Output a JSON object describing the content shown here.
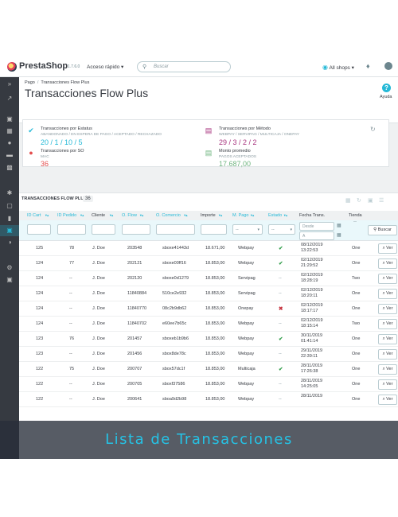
{
  "app": {
    "logo": "PrestaShop",
    "version": "1.7.6.0"
  },
  "topbar": {
    "quick_access": "Acceso rápido ▾",
    "search_placeholder": "Buscar",
    "shops": "All shops ▾"
  },
  "breadcrumb": {
    "parent": "Pago",
    "current": "Transacciones Flow Plus"
  },
  "page": {
    "title": "Transacciones Flow Plus",
    "help_label": "Ayuda"
  },
  "kpis": {
    "estatus": {
      "label": "Transacciones por Estatus",
      "sub": "ABANDONADO / EN ESPERA DE PAGO / ACEPTADO / RECHAZADO",
      "value": "20 / 1 / 10 / 5"
    },
    "metodo": {
      "label": "Transacciones por Método",
      "sub": "WEBPAY / SERVIPAG / MULTICAJA / ONEPAY",
      "value": "29 / 3 / 2 / 2"
    },
    "so": {
      "label": "Transacciones por SO",
      "sub": "MAC",
      "value": "36"
    },
    "monto": {
      "label": "Monto promedio",
      "sub": "PAGOS ACEPTADOS",
      "value": "17.687,00"
    }
  },
  "table": {
    "title": "TRANSACCIONES FLOW PLUS",
    "count": "36",
    "headers": [
      "ID Cart",
      "ID Pedido",
      "Cliente",
      "O. Flow",
      "O. Comercio",
      "Importe",
      "M. Pago",
      "Estado",
      "Fecha Trans.",
      "Tienda"
    ],
    "filters": {
      "select_placeholder": "--",
      "date_from": "Desde",
      "date_to": "A",
      "tienda_placeholder": "--",
      "search_button": "Buscar"
    },
    "view_label": "Ver",
    "rows": [
      {
        "cart": "125",
        "order": "78",
        "client": "J. Doe",
        "flow": "203548",
        "comercio": "sboxe41443d",
        "amount": "18.671,00",
        "method": "Webpay",
        "status": "ok",
        "date": "08/12/2019",
        "time": "13:22:53",
        "shop": "One"
      },
      {
        "cart": "124",
        "order": "77",
        "client": "J. Doe",
        "flow": "202121",
        "comercio": "sboxe00ff16",
        "amount": "18.853,00",
        "method": "Webpay",
        "status": "ok",
        "date": "02/12/2019",
        "time": "21:29:52",
        "shop": "One"
      },
      {
        "cart": "124",
        "order": "--",
        "client": "J. Doe",
        "flow": "202120",
        "comercio": "sboxe0d1279",
        "amount": "18.853,00",
        "method": "Servipag",
        "status": "--",
        "date": "02/12/2019",
        "time": "18:28:19",
        "shop": "Two"
      },
      {
        "cart": "124",
        "order": "--",
        "client": "J. Doe",
        "flow": "11840884",
        "comercio": "510ce2e932",
        "amount": "18.853,00",
        "method": "Servipag",
        "status": "--",
        "date": "02/12/2019",
        "time": "18:20:11",
        "shop": "One"
      },
      {
        "cart": "124",
        "order": "--",
        "client": "J. Doe",
        "flow": "11840770",
        "comercio": "08c2b9db62",
        "amount": "18.853,00",
        "method": "Onepay",
        "status": "x",
        "date": "02/12/2019",
        "time": "18:17:17",
        "shop": "One"
      },
      {
        "cart": "124",
        "order": "--",
        "client": "J. Doe",
        "flow": "11840702",
        "comercio": "e60ee7b65c",
        "amount": "18.853,00",
        "method": "Webpay",
        "status": "--",
        "date": "02/12/2019",
        "time": "18:15:14",
        "shop": "Two"
      },
      {
        "cart": "123",
        "order": "76",
        "client": "J. Doe",
        "flow": "201457",
        "comercio": "sboxeb1b9b6",
        "amount": "18.853,00",
        "method": "Webpay",
        "status": "ok",
        "date": "30/11/2019",
        "time": "01:41:14",
        "shop": "One"
      },
      {
        "cart": "123",
        "order": "--",
        "client": "J. Doe",
        "flow": "201456",
        "comercio": "sbox8de78c",
        "amount": "18.853,00",
        "method": "Webpay",
        "status": "--",
        "date": "29/11/2019",
        "time": "22:39:11",
        "shop": "One"
      },
      {
        "cart": "122",
        "order": "75",
        "client": "J. Doe",
        "flow": "200707",
        "comercio": "sbox57dc1f",
        "amount": "18.853,00",
        "method": "Multicaja",
        "status": "ok",
        "date": "28/11/2019",
        "time": "17:26:38",
        "shop": "One"
      },
      {
        "cart": "122",
        "order": "--",
        "client": "J. Doe",
        "flow": "200705",
        "comercio": "sboxf37586",
        "amount": "18.853,00",
        "method": "Webpay",
        "status": "--",
        "date": "28/11/2019",
        "time": "14:25:05",
        "shop": "One"
      },
      {
        "cart": "122",
        "order": "--",
        "client": "J. Doe",
        "flow": "200641",
        "comercio": "sboa9d2b98",
        "amount": "18.853,00",
        "method": "Webpay",
        "status": "--",
        "date": "28/11/2019",
        "time": "",
        "shop": "One"
      }
    ]
  },
  "banner": {
    "text": "Lista de Transacciones"
  },
  "colors": {
    "accent": "#25b9d7",
    "brand_magenta": "#a7337e",
    "success": "#70b580",
    "danger": "#e44d4d",
    "sidebar": "#363a41",
    "banner_text": "#25c3e6"
  }
}
